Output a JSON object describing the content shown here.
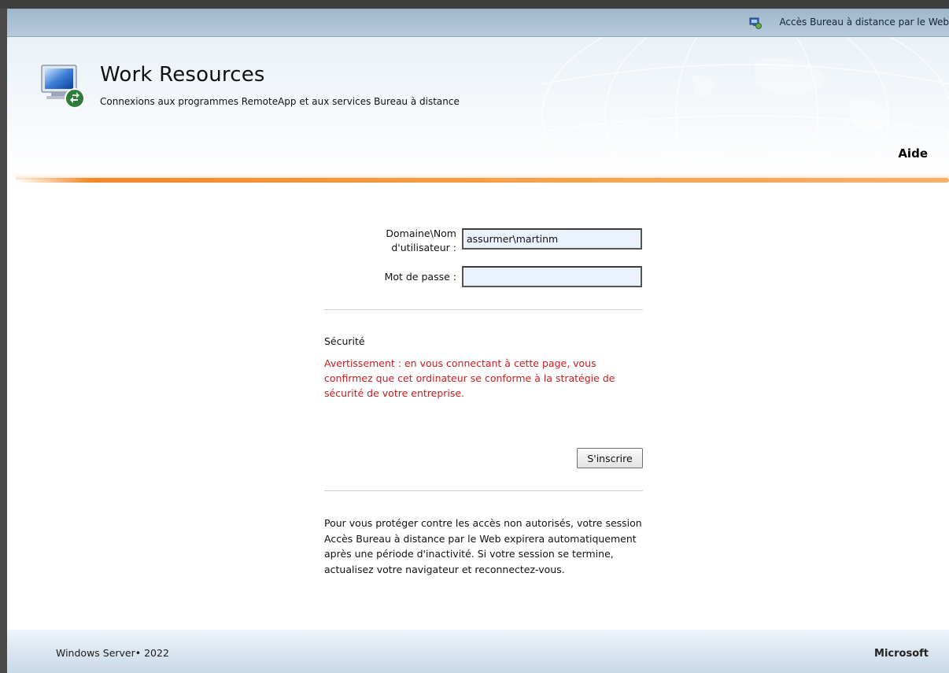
{
  "top_bar": {
    "link_text": "Accès Bureau à distance par le Web",
    "icon": "rdweb-icon"
  },
  "header": {
    "title": "Work Resources",
    "subtitle": "Connexions aux programmes RemoteApp et aux services Bureau à distance",
    "help_label": "Aide",
    "logo_icon": "remote-desktop-logo-icon"
  },
  "login": {
    "username_label_line1": "Domaine\\Nom",
    "username_label_line2": "d'utilisateur :",
    "username_value": "assurmer\\martinm",
    "password_label": "Mot de passe :",
    "password_value": ""
  },
  "security": {
    "title": "Sécurité",
    "warning": "Avertissement : en vous connectant à cette page, vous confirmez que cet ordinateur se conforme à la stratégie de sécurité de votre entreprise."
  },
  "signin_label": "S'inscrire",
  "notice": "Pour vous protéger contre les accès non autorisés, votre session Accès Bureau à distance par le Web expirera automatiquement après une période d'inactivité. Si votre session se termine, actualisez votre navigateur et reconnectez-vous.",
  "footer": {
    "left": "Windows Server• 2022",
    "right": "Microsoft"
  },
  "colors": {
    "accent_orange": "#f28a2a",
    "warning_red": "#c22020",
    "input_bg": "#e9f2fd"
  }
}
